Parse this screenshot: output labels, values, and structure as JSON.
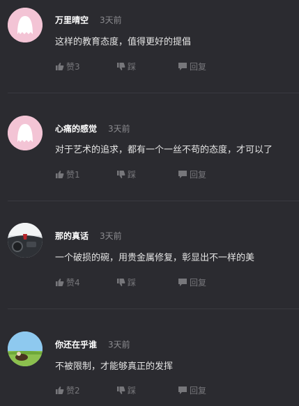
{
  "comments": [
    {
      "user": "万里晴空",
      "time": "3天前",
      "text": "这样的教育态度，值得更好的提倡",
      "like_label": "赞3",
      "dislike_label": "踩",
      "reply_label": "回复",
      "avatar": "pink-ghost-avatar"
    },
    {
      "user": "心痛的感觉",
      "time": "3天前",
      "text": "对于艺术的追求，都有一个一丝不苟的态度，才可以了",
      "like_label": "赞1",
      "dislike_label": "踩",
      "reply_label": "回复",
      "avatar": "pink-ghost-avatar"
    },
    {
      "user": "那的真话",
      "time": "3天前",
      "text": "一个破损的碗，用贵金属修复，彰显出不一样的美",
      "like_label": "赞4",
      "dislike_label": "踩",
      "reply_label": "回复",
      "avatar": "car-interior-avatar"
    },
    {
      "user": "你还在乎谁",
      "time": "3天前",
      "text": "不被限制，才能够真正的发挥",
      "like_label": "赞2",
      "dislike_label": "踩",
      "reply_label": "回复",
      "avatar": "field-landscape-avatar"
    }
  ],
  "colors": {
    "background": "#2b2b30",
    "username": "#ffffff",
    "timestamp": "#8b8b8f",
    "action": "#77777b",
    "ghost_avatar_bg": "#f4c6d6"
  }
}
